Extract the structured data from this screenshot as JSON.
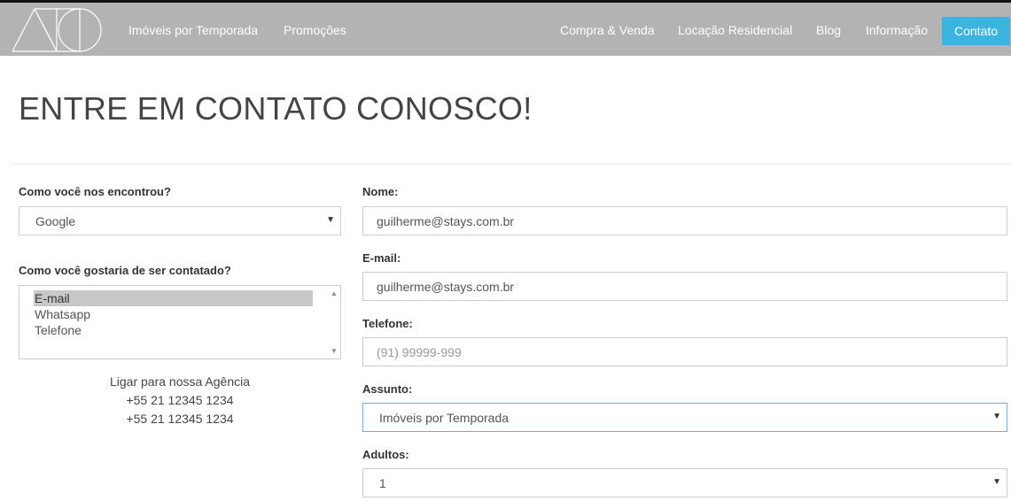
{
  "nav": {
    "logo_icon": "geometric-logo-icon",
    "left_items": [
      "Imóveis por Temporada",
      "Promoções"
    ],
    "right_items": [
      "Compra & Venda",
      "Locação Residencial",
      "Blog",
      "Informação"
    ],
    "active_item": "Contato",
    "active_color": "#3bb5e0",
    "bar_color": "#b3b3b3"
  },
  "page": {
    "title": "ENTRE EM CONTATO CONOSCO!"
  },
  "left_form": {
    "found_label": "Como você nos encontrou?",
    "found_value": "Google",
    "contact_label": "Como você gostaria de ser contatado?",
    "contact_options": [
      "E-mail",
      "Whatsapp",
      "Telefone"
    ],
    "contact_selected": "E-mail",
    "agency_label": "Ligar para nossa Agência",
    "agency_phones": [
      "+55 21 12345 1234",
      "+55 21 12345 1234"
    ]
  },
  "right_form": {
    "name_label": "Nome:",
    "name_value": "guilherme@stays.com.br",
    "email_label": "E-mail:",
    "email_value": "guilherme@stays.com.br",
    "phone_label": "Telefone:",
    "phone_placeholder": "(91) 99999-999",
    "subject_label": "Assunto:",
    "subject_value": "Imóveis por Temporada",
    "adults_label": "Adultos:",
    "adults_value": "1"
  }
}
